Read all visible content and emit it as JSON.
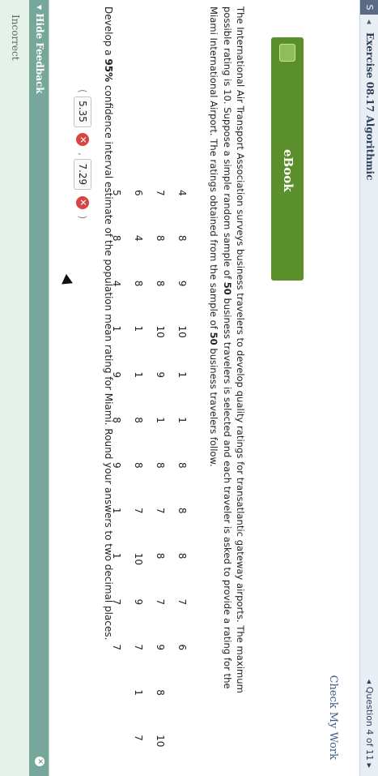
{
  "header": {
    "left_tag": "S",
    "title": "Exercise 08.17 Algorithmic",
    "question_nav": "◂ Question 4 of 11 ▸",
    "check_work": "Check My Work"
  },
  "ebook": {
    "label": "eBook"
  },
  "problem": {
    "intro_line1": "The International Air Transport Association surveys business travelers to develop quality ratings for transatlantic gateway airports. The maximum",
    "intro_line2_a": "possible rating is 10. Suppose a simple random sample of ",
    "intro_line2_b": "50",
    "intro_line2_c": " business travelers is selected and each traveler is asked to provide a rating for the",
    "intro_line3_a": "Miami International Airport. The ratings obtained from the sample of ",
    "intro_line3_b": "50",
    "intro_line3_c": " business travelers follow.",
    "ratings": [
      [
        "4",
        "8",
        "9",
        "10",
        "1",
        "1",
        "8",
        "8",
        "8",
        "7",
        "6"
      ],
      [
        "7",
        "8",
        "8",
        "10",
        "9",
        "1",
        "8",
        "7",
        "8",
        "7",
        "9",
        "8",
        "10"
      ],
      [
        "6",
        "4",
        "8",
        "1",
        "1",
        "8",
        "8",
        "7",
        "10",
        "9",
        "7",
        "1",
        "7"
      ],
      [
        "5",
        "8",
        "4",
        "1",
        "9",
        "8",
        "9",
        "1",
        "1",
        "7",
        "7"
      ]
    ],
    "question_a": "Develop a ",
    "question_b": "95%",
    "question_c": " confidence interval estimate of the population mean rating for Miami. Round your answers to two decimal places."
  },
  "answers": {
    "open_paren": "(",
    "lower": "5.35",
    "comma": ",",
    "upper": "7.29",
    "close_paren": ")"
  },
  "feedback": {
    "hide_label": "▾ Hide Feedback",
    "status": "Incorrect"
  }
}
